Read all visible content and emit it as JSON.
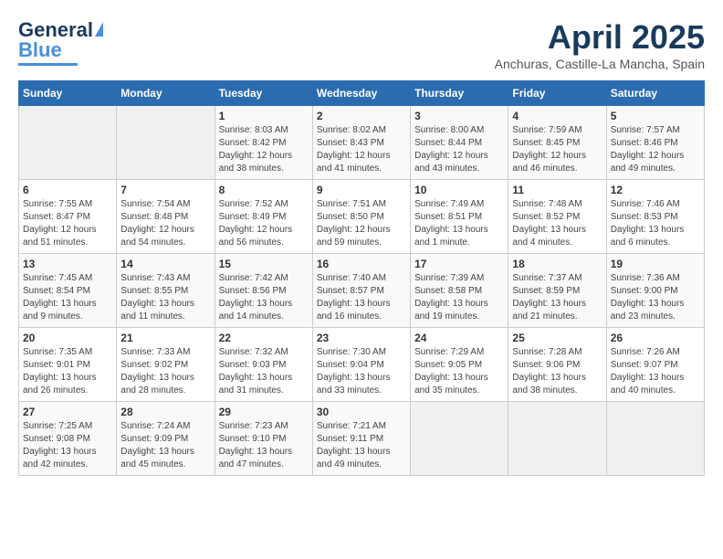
{
  "header": {
    "logo_general": "General",
    "logo_blue": "Blue",
    "month_title": "April 2025",
    "subtitle": "Anchuras, Castille-La Mancha, Spain"
  },
  "weekdays": [
    "Sunday",
    "Monday",
    "Tuesday",
    "Wednesday",
    "Thursday",
    "Friday",
    "Saturday"
  ],
  "weeks": [
    [
      {
        "day": "",
        "sunrise": "",
        "sunset": "",
        "daylight": ""
      },
      {
        "day": "",
        "sunrise": "",
        "sunset": "",
        "daylight": ""
      },
      {
        "day": "1",
        "sunrise": "Sunrise: 8:03 AM",
        "sunset": "Sunset: 8:42 PM",
        "daylight": "Daylight: 12 hours and 38 minutes."
      },
      {
        "day": "2",
        "sunrise": "Sunrise: 8:02 AM",
        "sunset": "Sunset: 8:43 PM",
        "daylight": "Daylight: 12 hours and 41 minutes."
      },
      {
        "day": "3",
        "sunrise": "Sunrise: 8:00 AM",
        "sunset": "Sunset: 8:44 PM",
        "daylight": "Daylight: 12 hours and 43 minutes."
      },
      {
        "day": "4",
        "sunrise": "Sunrise: 7:59 AM",
        "sunset": "Sunset: 8:45 PM",
        "daylight": "Daylight: 12 hours and 46 minutes."
      },
      {
        "day": "5",
        "sunrise": "Sunrise: 7:57 AM",
        "sunset": "Sunset: 8:46 PM",
        "daylight": "Daylight: 12 hours and 49 minutes."
      }
    ],
    [
      {
        "day": "6",
        "sunrise": "Sunrise: 7:55 AM",
        "sunset": "Sunset: 8:47 PM",
        "daylight": "Daylight: 12 hours and 51 minutes."
      },
      {
        "day": "7",
        "sunrise": "Sunrise: 7:54 AM",
        "sunset": "Sunset: 8:48 PM",
        "daylight": "Daylight: 12 hours and 54 minutes."
      },
      {
        "day": "8",
        "sunrise": "Sunrise: 7:52 AM",
        "sunset": "Sunset: 8:49 PM",
        "daylight": "Daylight: 12 hours and 56 minutes."
      },
      {
        "day": "9",
        "sunrise": "Sunrise: 7:51 AM",
        "sunset": "Sunset: 8:50 PM",
        "daylight": "Daylight: 12 hours and 59 minutes."
      },
      {
        "day": "10",
        "sunrise": "Sunrise: 7:49 AM",
        "sunset": "Sunset: 8:51 PM",
        "daylight": "Daylight: 13 hours and 1 minute."
      },
      {
        "day": "11",
        "sunrise": "Sunrise: 7:48 AM",
        "sunset": "Sunset: 8:52 PM",
        "daylight": "Daylight: 13 hours and 4 minutes."
      },
      {
        "day": "12",
        "sunrise": "Sunrise: 7:46 AM",
        "sunset": "Sunset: 8:53 PM",
        "daylight": "Daylight: 13 hours and 6 minutes."
      }
    ],
    [
      {
        "day": "13",
        "sunrise": "Sunrise: 7:45 AM",
        "sunset": "Sunset: 8:54 PM",
        "daylight": "Daylight: 13 hours and 9 minutes."
      },
      {
        "day": "14",
        "sunrise": "Sunrise: 7:43 AM",
        "sunset": "Sunset: 8:55 PM",
        "daylight": "Daylight: 13 hours and 11 minutes."
      },
      {
        "day": "15",
        "sunrise": "Sunrise: 7:42 AM",
        "sunset": "Sunset: 8:56 PM",
        "daylight": "Daylight: 13 hours and 14 minutes."
      },
      {
        "day": "16",
        "sunrise": "Sunrise: 7:40 AM",
        "sunset": "Sunset: 8:57 PM",
        "daylight": "Daylight: 13 hours and 16 minutes."
      },
      {
        "day": "17",
        "sunrise": "Sunrise: 7:39 AM",
        "sunset": "Sunset: 8:58 PM",
        "daylight": "Daylight: 13 hours and 19 minutes."
      },
      {
        "day": "18",
        "sunrise": "Sunrise: 7:37 AM",
        "sunset": "Sunset: 8:59 PM",
        "daylight": "Daylight: 13 hours and 21 minutes."
      },
      {
        "day": "19",
        "sunrise": "Sunrise: 7:36 AM",
        "sunset": "Sunset: 9:00 PM",
        "daylight": "Daylight: 13 hours and 23 minutes."
      }
    ],
    [
      {
        "day": "20",
        "sunrise": "Sunrise: 7:35 AM",
        "sunset": "Sunset: 9:01 PM",
        "daylight": "Daylight: 13 hours and 26 minutes."
      },
      {
        "day": "21",
        "sunrise": "Sunrise: 7:33 AM",
        "sunset": "Sunset: 9:02 PM",
        "daylight": "Daylight: 13 hours and 28 minutes."
      },
      {
        "day": "22",
        "sunrise": "Sunrise: 7:32 AM",
        "sunset": "Sunset: 9:03 PM",
        "daylight": "Daylight: 13 hours and 31 minutes."
      },
      {
        "day": "23",
        "sunrise": "Sunrise: 7:30 AM",
        "sunset": "Sunset: 9:04 PM",
        "daylight": "Daylight: 13 hours and 33 minutes."
      },
      {
        "day": "24",
        "sunrise": "Sunrise: 7:29 AM",
        "sunset": "Sunset: 9:05 PM",
        "daylight": "Daylight: 13 hours and 35 minutes."
      },
      {
        "day": "25",
        "sunrise": "Sunrise: 7:28 AM",
        "sunset": "Sunset: 9:06 PM",
        "daylight": "Daylight: 13 hours and 38 minutes."
      },
      {
        "day": "26",
        "sunrise": "Sunrise: 7:26 AM",
        "sunset": "Sunset: 9:07 PM",
        "daylight": "Daylight: 13 hours and 40 minutes."
      }
    ],
    [
      {
        "day": "27",
        "sunrise": "Sunrise: 7:25 AM",
        "sunset": "Sunset: 9:08 PM",
        "daylight": "Daylight: 13 hours and 42 minutes."
      },
      {
        "day": "28",
        "sunrise": "Sunrise: 7:24 AM",
        "sunset": "Sunset: 9:09 PM",
        "daylight": "Daylight: 13 hours and 45 minutes."
      },
      {
        "day": "29",
        "sunrise": "Sunrise: 7:23 AM",
        "sunset": "Sunset: 9:10 PM",
        "daylight": "Daylight: 13 hours and 47 minutes."
      },
      {
        "day": "30",
        "sunrise": "Sunrise: 7:21 AM",
        "sunset": "Sunset: 9:11 PM",
        "daylight": "Daylight: 13 hours and 49 minutes."
      },
      {
        "day": "",
        "sunrise": "",
        "sunset": "",
        "daylight": ""
      },
      {
        "day": "",
        "sunrise": "",
        "sunset": "",
        "daylight": ""
      },
      {
        "day": "",
        "sunrise": "",
        "sunset": "",
        "daylight": ""
      }
    ]
  ]
}
